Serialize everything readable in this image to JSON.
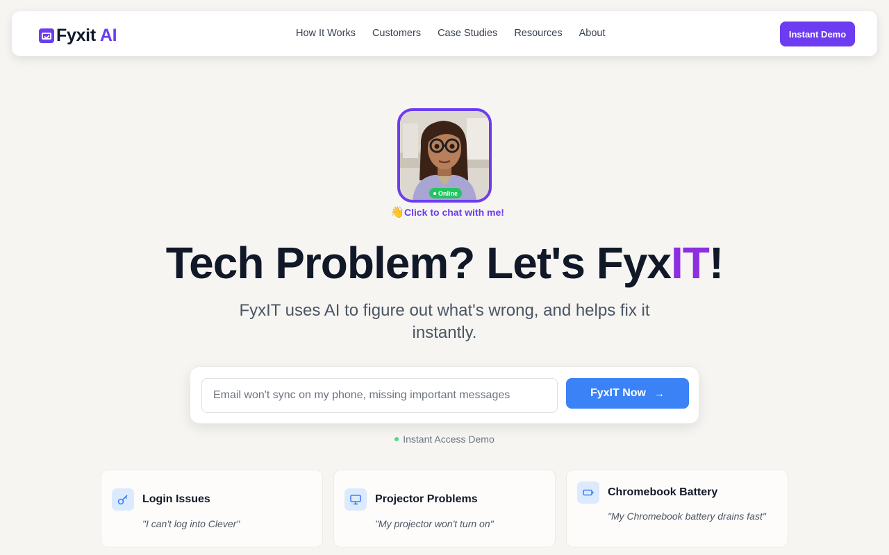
{
  "nav": {
    "logo_name": "Fyxit",
    "logo_ai": "AI",
    "links": [
      "How It Works",
      "Customers",
      "Case Studies",
      "Resources",
      "About"
    ],
    "cta_label": "Instant Demo"
  },
  "avatar": {
    "status": "Online",
    "chat_prompt": "Click to chat with me!"
  },
  "hero": {
    "title_prefix": "Tech Problem? Let's Fyx",
    "title_accent": "IT",
    "title_suffix": "!",
    "subtitle": "FyxIT uses AI to figure out what's wrong, and helps fix it instantly."
  },
  "search": {
    "placeholder": "Email won't sync on my phone, missing important messages",
    "button_label": "FyxIT Now",
    "access_note": "Instant Access Demo"
  },
  "cards": [
    {
      "icon": "key-icon",
      "title": "Login Issues",
      "quote": "\"I can't log into Clever\""
    },
    {
      "icon": "monitor-icon",
      "title": "Projector Problems",
      "quote": "\"My projector won't turn on\""
    },
    {
      "icon": "battery-icon",
      "title": "Chromebook Battery",
      "quote": "\"My Chromebook battery drains fast\""
    }
  ],
  "colors": {
    "brand_purple": "#6d3cf0",
    "accent_violet": "#8b2fe0",
    "primary_blue": "#3b82f6",
    "online_green": "#22c55e",
    "background": "#f6f5f2"
  }
}
